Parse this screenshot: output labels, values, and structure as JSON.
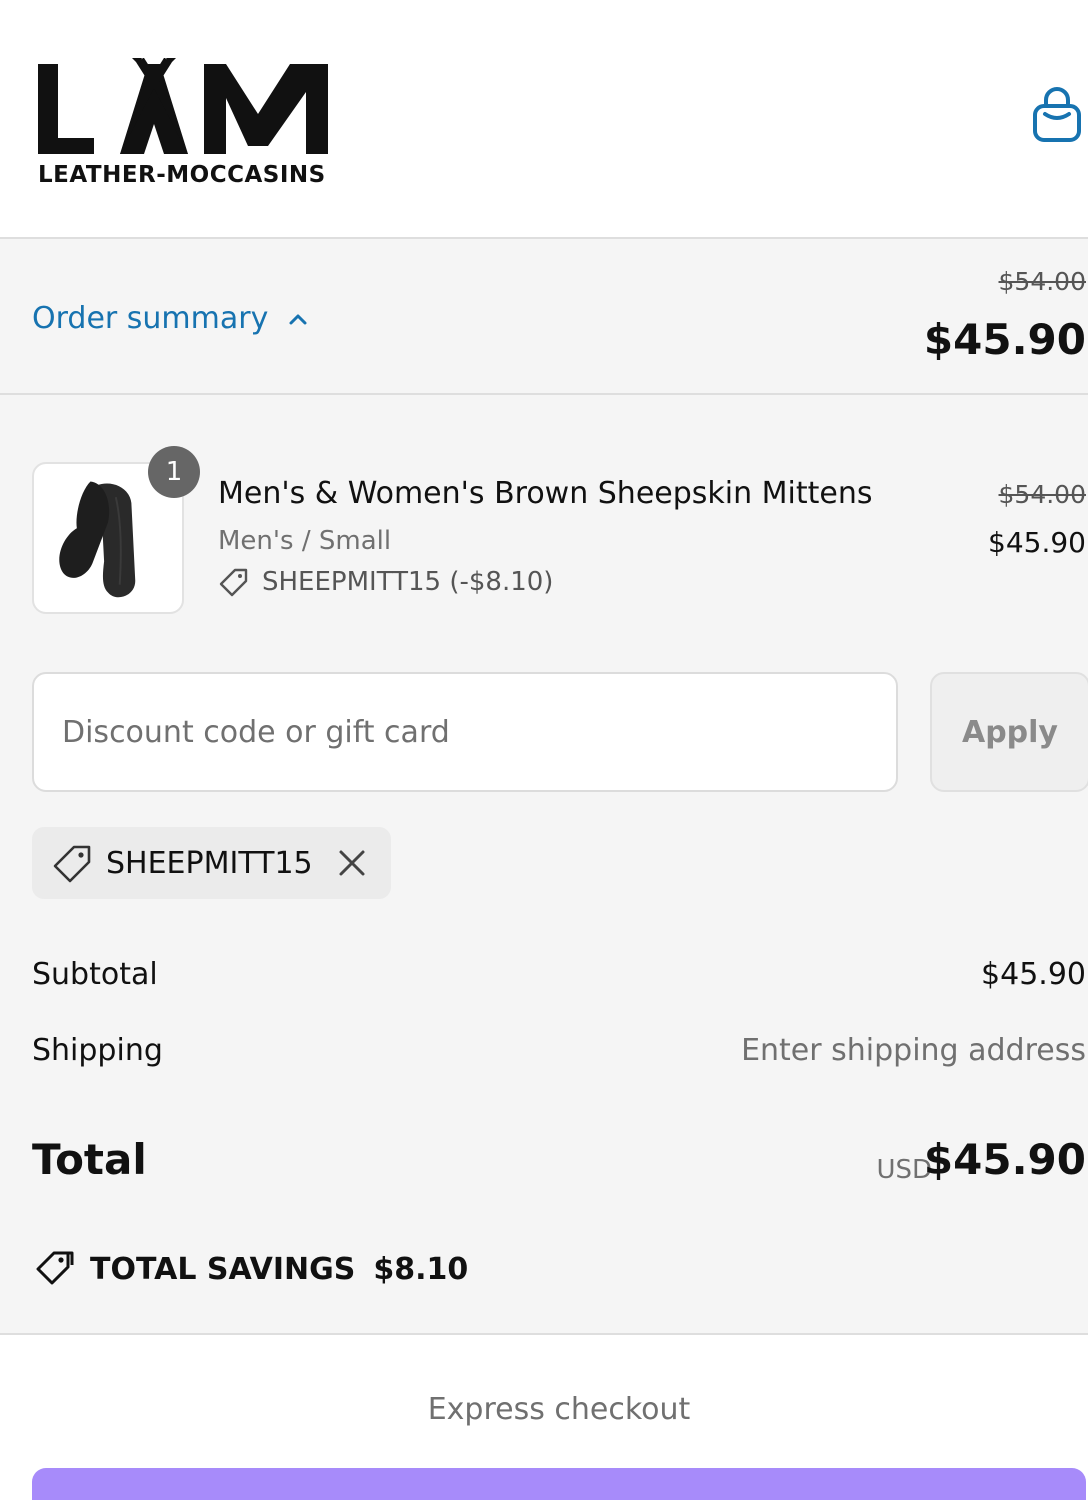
{
  "brand": {
    "logo_letters": "LAM",
    "logo_tagline": "LEATHER-MOCCASINS"
  },
  "summary_bar": {
    "toggle_label": "Order summary",
    "original_price": "$54.00",
    "price": "$45.90"
  },
  "item": {
    "quantity": "1",
    "name": "Men's & Women's Brown Sheepskin Mittens",
    "variant": "Men's / Small",
    "discount": "SHEEPMITT15 (-$8.10)",
    "original_price": "$54.00",
    "price": "$45.90"
  },
  "discount": {
    "placeholder": "Discount code or gift card",
    "apply_label": "Apply",
    "applied_code": "SHEEPMITT15"
  },
  "totals": {
    "subtotal_label": "Subtotal",
    "subtotal_value": "$45.90",
    "shipping_label": "Shipping",
    "shipping_value": "Enter shipping address",
    "total_label": "Total",
    "currency": "USD",
    "total_value": "$45.90",
    "savings_label": "TOTAL SAVINGS",
    "savings_value": "$8.10"
  },
  "express": {
    "label": "Express checkout"
  },
  "colors": {
    "link": "#1773b0",
    "panel": "#f5f5f5",
    "shop_pay": "#a78bfa"
  }
}
